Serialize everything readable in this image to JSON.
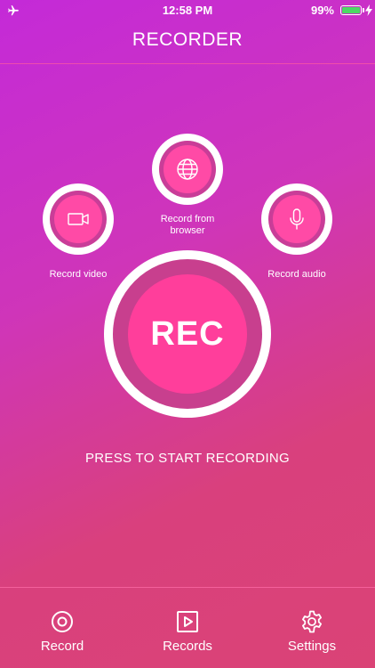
{
  "status_bar": {
    "time": "12:58 PM",
    "battery_percent": "99%",
    "battery_level": 0.99,
    "left_icon": "airplane-icon",
    "right_icon": "charging-bolt-icon"
  },
  "header": {
    "title": "RECORDER"
  },
  "options": {
    "video": {
      "label": "Record video",
      "icon": "video-camera-icon"
    },
    "browser": {
      "label_line1": "Record from",
      "label_line2": "browser",
      "icon": "globe-icon"
    },
    "audio": {
      "label": "Record audio",
      "icon": "microphone-icon"
    }
  },
  "rec_button": {
    "label": "REC"
  },
  "hint": "PRESS TO START RECORDING",
  "tabs": [
    {
      "label": "Record",
      "icon": "record-icon"
    },
    {
      "label": "Records",
      "icon": "play-square-icon"
    },
    {
      "label": "Settings",
      "icon": "gear-icon"
    }
  ],
  "colors": {
    "accent_pink": "#ff3e9b",
    "ring_dark": "#c83f8e",
    "battery_green": "#4cd964"
  }
}
